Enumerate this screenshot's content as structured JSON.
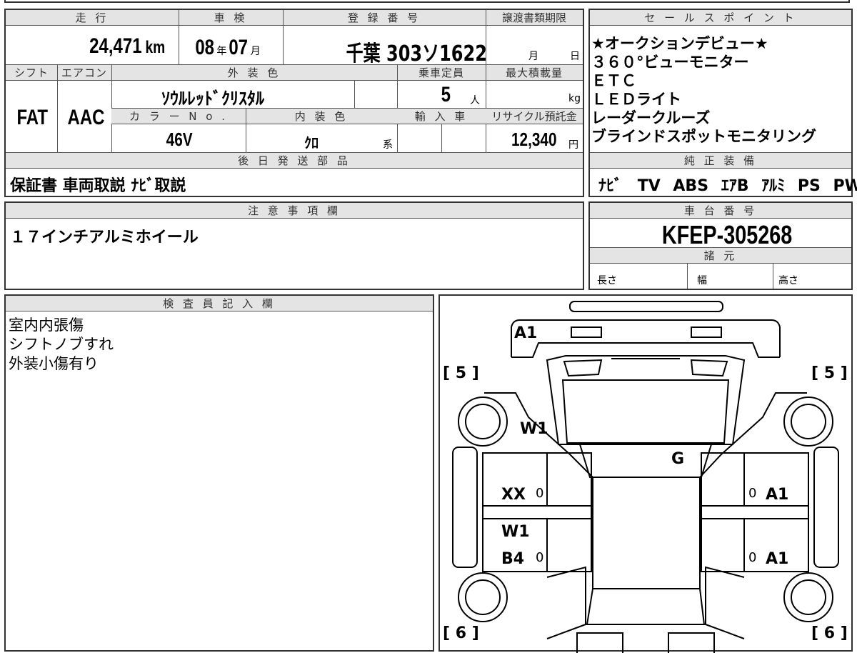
{
  "top_row": {
    "mileage_header": "走 行",
    "mileage_value": "24,471",
    "mileage_unit": "km",
    "inspection_header": "車 検",
    "inspection_year": "08",
    "inspection_year_unit": "年",
    "inspection_month": "07",
    "inspection_month_unit": "月",
    "plate_header": "登 録 番 号",
    "plate_value": "千葉 303ソ1622",
    "transfer_header": "譲渡書類期限",
    "transfer_month": "月",
    "transfer_day": "日"
  },
  "mid_row": {
    "shift_header": "シフト",
    "shift_value": "FAT",
    "ac_header": "エアコン",
    "ac_value": "AAC",
    "ext_color_header": "外 装 色",
    "ext_color_value": "ｿｳﾙﾚｯﾄﾞｸﾘｽﾀﾙ",
    "capacity_header": "乗車定員",
    "capacity_value": "5",
    "capacity_unit": "人",
    "load_header": "最大積載量",
    "load_unit": "kg",
    "color_no_header": "カ ラ ー N o .",
    "color_no_value": "46V",
    "int_color_header": "内 装 色",
    "int_color_value": "ｸﾛ",
    "int_color_suffix": "系",
    "import_header": "輸 入 車",
    "recycle_header": "リサイクル預託金",
    "recycle_value": "12,340",
    "recycle_unit": "円"
  },
  "later_parts": {
    "header": "後 日 発 送 部 品",
    "value": "保証書 車両取説 ﾅﾋﾞ取説"
  },
  "sales_points": {
    "header": "セ ー ル ス ポ イ ン ト",
    "items": [
      "★オークションデビュー★",
      "３６０°ビューモニター",
      "ＥＴＣ",
      "ＬＥＤライト",
      "レーダークルーズ",
      "ブラインドスポットモニタリング"
    ]
  },
  "equipment": {
    "header": "純 正 装 備",
    "items": [
      "ﾅﾋﾞ",
      "TV",
      "ABS",
      "ｴｱB",
      "ｱﾙﾐ",
      "PS",
      "PW"
    ]
  },
  "notes": {
    "header": "注 意 事 項 欄",
    "value": "１７インチアルミホイール"
  },
  "chassis": {
    "header": "車 台 番 号",
    "value": "KFEP-305268",
    "specs_header": "諸 元",
    "length_label": "長さ",
    "width_label": "幅",
    "height_label": "高さ"
  },
  "inspector": {
    "header": "検 査 員 記 入 欄",
    "lines": [
      "室内内張傷",
      "シフトノブすれ",
      "外装小傷有り"
    ]
  },
  "diagram": {
    "marks": {
      "front": "A1",
      "tire_fl": "5",
      "tire_fr": "5",
      "tire_rl": "6",
      "tire_rr": "6",
      "windshield": "W1",
      "roof": "G",
      "left_front_door": "XX",
      "left_rear_door_window": "W1",
      "left_rear_door": "B4",
      "right_front_door": "A1",
      "right_rear_door": "A1",
      "door_marker": "0"
    }
  }
}
